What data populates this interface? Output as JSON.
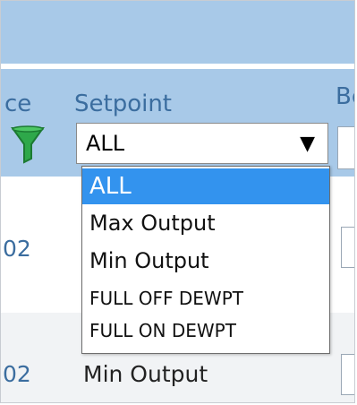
{
  "table": {
    "header_left_fragment": "ce",
    "header_setpoint": "Setpoint",
    "header_right_fragment": "Be"
  },
  "filter": {
    "selected_value": "ALL",
    "options": [
      "ALL",
      "Max Output",
      "Min Output",
      "FULL OFF DEWPT",
      "FULL ON DEWPT"
    ],
    "highlight_color": "#3393ee"
  },
  "rows": [
    {
      "id": "02",
      "value": ""
    },
    {
      "id": "02",
      "value": "Min Output"
    }
  ],
  "colors": {
    "header_bg": "#a8c9e8",
    "header_text": "#3b6d9f",
    "filter_icon": "#2ea84a"
  }
}
